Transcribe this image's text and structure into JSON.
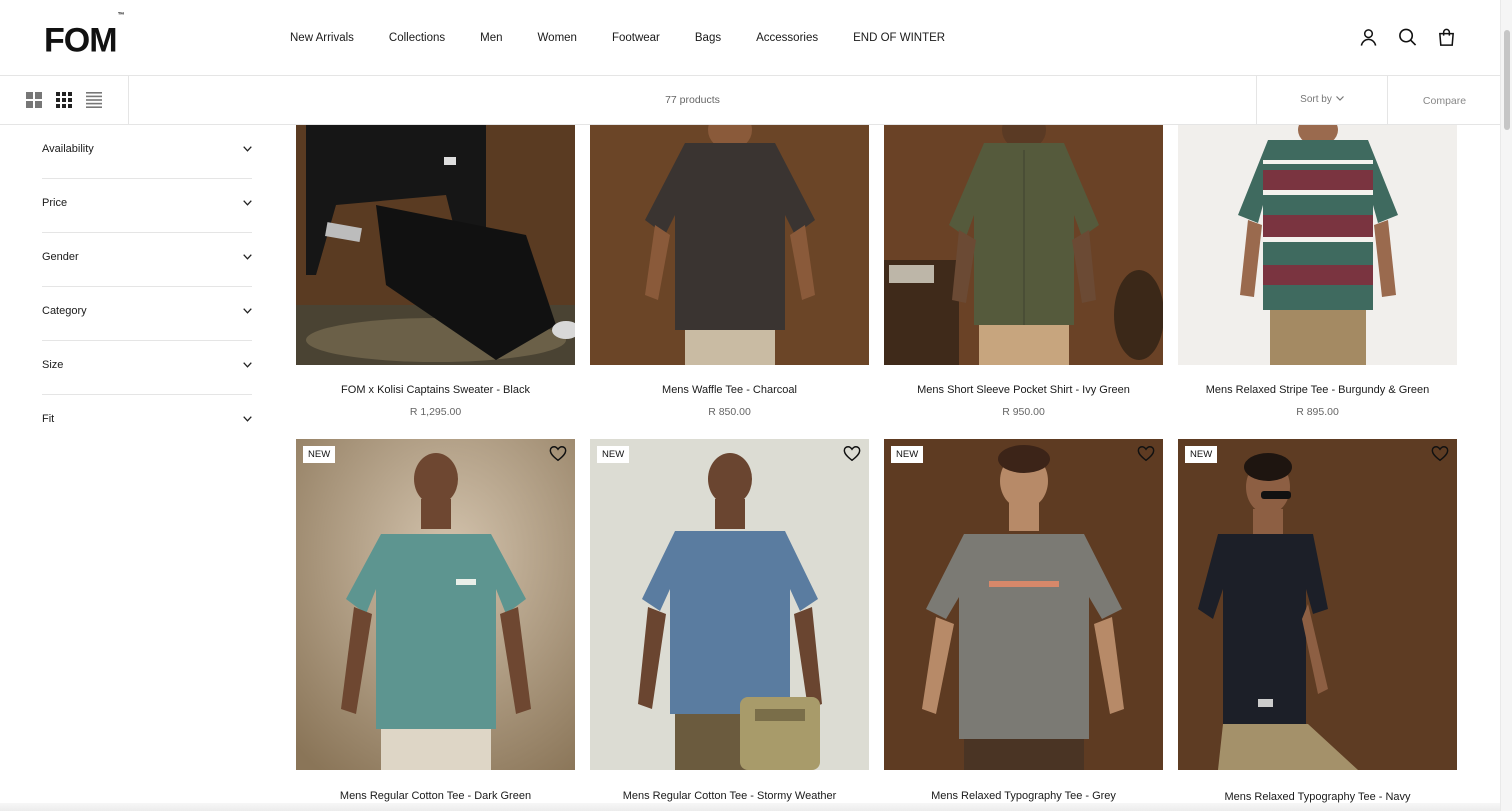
{
  "brand": {
    "logo_text": "FOM",
    "logo_mark": "™"
  },
  "nav": {
    "items": [
      {
        "label": "New Arrivals"
      },
      {
        "label": "Collections"
      },
      {
        "label": "Men"
      },
      {
        "label": "Women"
      },
      {
        "label": "Footwear"
      },
      {
        "label": "Bags"
      },
      {
        "label": "Accessories"
      },
      {
        "label": "END OF WINTER"
      }
    ],
    "icons": [
      "account-icon",
      "search-icon",
      "cart-bag-icon"
    ]
  },
  "toolbar": {
    "product_count": "77 products",
    "sort_label": "Sort by",
    "compare_label": "Compare",
    "view_icons": [
      "grid-2-icon",
      "grid-3-icon",
      "list-icon"
    ]
  },
  "filters": [
    {
      "label": "Availability"
    },
    {
      "label": "Price"
    },
    {
      "label": "Gender"
    },
    {
      "label": "Category"
    },
    {
      "label": "Size"
    },
    {
      "label": "Fit"
    }
  ],
  "products": [
    {
      "title": "FOM x Kolisi Captains Sweater - Black",
      "price": "R 1,295.00"
    },
    {
      "title": "Mens Waffle Tee - Charcoal",
      "price": "R 850.00"
    },
    {
      "title": "Mens Short Sleeve Pocket Shirt - Ivy Green",
      "price": "R 950.00"
    },
    {
      "title": "Mens Relaxed Stripe Tee - Burgundy & Green",
      "price": "R 895.00"
    },
    {
      "title": "Mens Regular Cotton Tee - Dark Green",
      "badge": "NEW"
    },
    {
      "title": "Mens Regular Cotton Tee - Stormy Weather",
      "badge": "NEW"
    },
    {
      "title": "Mens Relaxed Typography Tee - Grey",
      "badge": "NEW"
    },
    {
      "title": "Mens Relaxed Typography Tee - Navy",
      "badge": "NEW"
    }
  ],
  "colors": {
    "text": "#1a1a1a",
    "muted": "#666666",
    "border": "#e5e5e5",
    "wood_backdrop": "#6b4527"
  }
}
